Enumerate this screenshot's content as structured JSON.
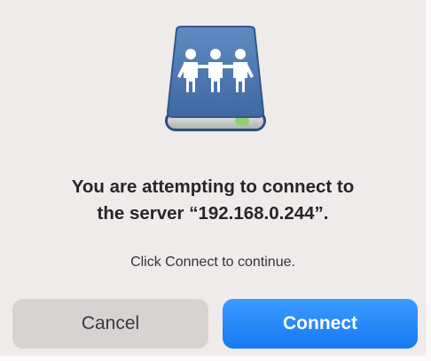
{
  "dialog": {
    "title_line1": "You are attempting to connect to",
    "title_line2": "the server “192.168.0.244”.",
    "subtitle": "Click Connect to continue.",
    "icon": "shared-network-server-icon",
    "cancel_label": "Cancel",
    "connect_label": "Connect",
    "accent_color": "#1a7ef5"
  }
}
